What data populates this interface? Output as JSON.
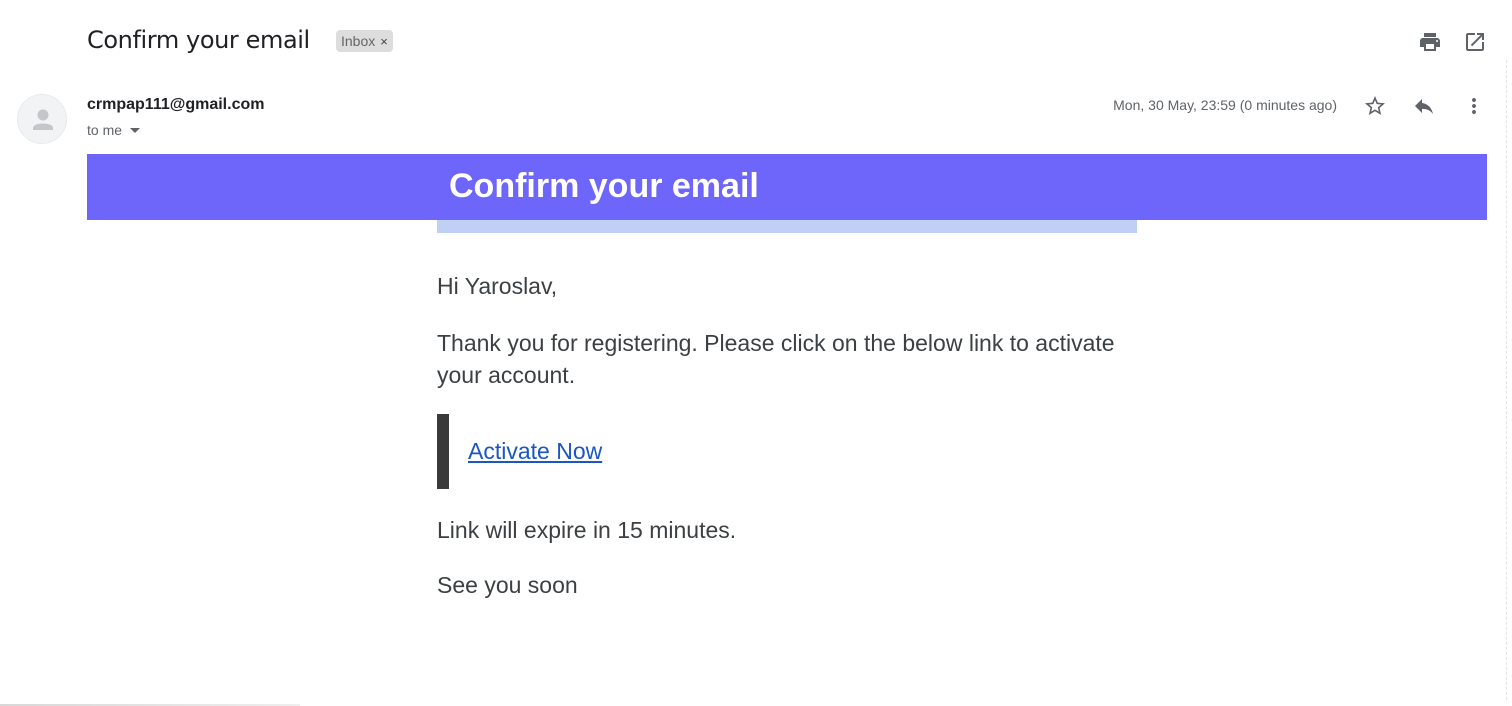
{
  "header": {
    "subject": "Confirm your email",
    "label": "Inbox",
    "label_close": "×",
    "print_icon": "print-icon",
    "open_new_window_icon": "open-in-new-window-icon"
  },
  "message": {
    "sender": "crmpap111@gmail.com",
    "recipient": "to me",
    "date": "Mon, 30 May, 23:59 (0 minutes ago)",
    "actions": [
      "star-icon",
      "reply-icon",
      "more-vert-icon"
    ]
  },
  "email_body": {
    "banner_title": "Confirm your email",
    "greeting": "Hi Yaroslav,",
    "paragraph": "Thank you for registering. Please click on the below link to activate your account.",
    "link_text": "Activate Now",
    "expiry": "Link will expire in 15 minutes.",
    "signoff": "See you soon"
  },
  "colors": {
    "banner": "#6e66fa",
    "underbar": "#c0d0f5",
    "link": "#1a56c8",
    "cta_border": "#3a3a3a"
  }
}
